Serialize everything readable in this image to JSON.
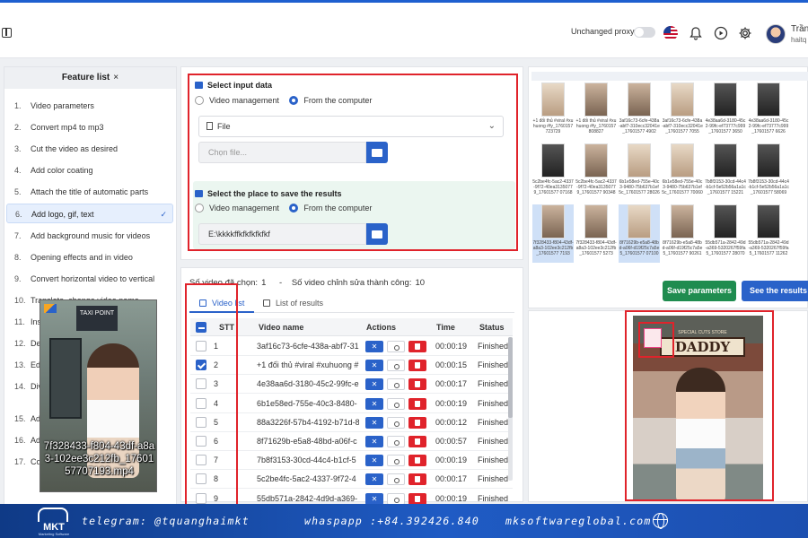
{
  "header": {
    "proxy_label": "Unchanged proxy",
    "user_name": "Trần",
    "user_sub": "haitq"
  },
  "feature_list": {
    "title": "Feature list",
    "close": "×",
    "items": [
      {
        "num": "1.",
        "label": "Video parameters"
      },
      {
        "num": "2.",
        "label": "Convert mp4 to mp3"
      },
      {
        "num": "3.",
        "label": "Cut the video as desired"
      },
      {
        "num": "4.",
        "label": "Add color coating"
      },
      {
        "num": "5.",
        "label": "Attach the title of automatic parts"
      },
      {
        "num": "6.",
        "label": "Add logo, gif, text"
      },
      {
        "num": "7.",
        "label": "Add background music for videos"
      },
      {
        "num": "8.",
        "label": "Opening effects and in video"
      },
      {
        "num": "9.",
        "label": "Convert horizontal video to vertical"
      },
      {
        "num": "10.",
        "label": "Translate, change video name"
      },
      {
        "num": "11.",
        "label": "Insert"
      },
      {
        "num": "12.",
        "label": "Delete"
      },
      {
        "num": "13.",
        "label": "Edit"
      },
      {
        "num": "14.",
        "label": "Divide parts"
      },
      {
        "num": "15.",
        "label": "Add"
      },
      {
        "num": "16.",
        "label": "Add"
      },
      {
        "num": "17.",
        "label": "Convert"
      }
    ],
    "active_check": "✓"
  },
  "overlay": {
    "sign_text": "TAXI POINT",
    "caption": "7f328433-f804-43df-a8a3-102ee3c212fb_1760157707193.mp4"
  },
  "input_section": {
    "title": "Select input data",
    "option_a": "Video management",
    "option_b": "From the computer",
    "file_select": "File",
    "chevron": "⌄",
    "file_placeholder": "Chọn file..."
  },
  "save_section": {
    "title": "Select the place to save the results",
    "option_a": "Video management",
    "option_b": "From the computer",
    "path": "E:\\kkkkffkfkfkfkfkf"
  },
  "grid": {
    "thumbs": [
      {
        "label": "+1 đối thủ #viral #xuhuong #fy_1760157723729"
      },
      {
        "label": "+1 đối thủ #viral #xuhuong #fy_1760157808827"
      },
      {
        "label": "3af16c73-6cfe-438a-abf7-310ecc32041e_17601577 4902"
      },
      {
        "label": "3af16c73-6cfe-438a-abf7-310ecc32041e_17601577 7055"
      },
      {
        "label": "4e38aa6d-3180-45c2-99fc-ef73777c999_17601577 3650"
      },
      {
        "label": "4e38aa6d-3180-45c2-99fc-ef73777c999_17601577 6626"
      },
      {
        "label": "5c2be4fc-5ac2-4337-9f72-40ea31350779_17601577 07168"
      },
      {
        "label": "5c2be4fc-5ac2-4337-9f72-40ea31350779_17601577 90348"
      },
      {
        "label": "6b1e58ed-755e-40c3-9480-75b637b1ef5c_17601577 28026"
      },
      {
        "label": "6b1e58ed-755e-40c3-9480-75b637b1ef5c_17601577 70060"
      },
      {
        "label": "7b8f3153-30cd-44c4-b1cf-5e52b56a1a1c_17601577 15221"
      },
      {
        "label": "7b8f3153-30cd-44c4-b1cf-5e52b56a1a1c_17601577 58069"
      },
      {
        "label": "7f328433-f804-43df-a8a3-102ee3c212fb_17601577 7193"
      },
      {
        "label": "7f328433-f804-43df-a8a3-102ee3c212fb_17601577 5273"
      },
      {
        "label": "8f71629b-e5a8-48bd-a06f-d19f25c7a5e5_17601577 07100"
      },
      {
        "label": "8f71629b-e5a8-48bd-a06f-d19f25c7a5e5_17601577 90261"
      },
      {
        "label": "55db571a-2842-49d-a369-5320267f59fa5_17601577 28070"
      },
      {
        "label": "55db571a-2842-49d-a369-5320267f59fa5_17601577 11262"
      }
    ],
    "save_btn": "Save parameters",
    "see_btn": "See the results fo"
  },
  "preview": {
    "sign": "DADDY",
    "sub_sign": "SPECIAL CUTS STORE"
  },
  "results": {
    "selected_label": "Số video đã chọn:",
    "selected_count": "1",
    "sep": "-",
    "success_label": "Số video chỉnh sửa thành công:",
    "success_count": "10",
    "tab_video_list": "Video list",
    "tab_results": "List of results",
    "columns": {
      "stt": "STT",
      "name": "Video name",
      "actions": "Actions",
      "time": "Time",
      "status": "Status"
    },
    "rows": [
      {
        "stt": "1",
        "name": "3af16c73-6cfe-438a-abf7-31",
        "time": "00:00:19",
        "status": "Finished",
        "checked": false
      },
      {
        "stt": "2",
        "name": "+1 đối thủ #viral #xuhuong #",
        "time": "00:00:15",
        "status": "Finished",
        "checked": true
      },
      {
        "stt": "3",
        "name": "4e38aa6d-3180-45c2-99fc-e",
        "time": "00:00:17",
        "status": "Finished",
        "checked": false
      },
      {
        "stt": "4",
        "name": "6b1e58ed-755e-40c3-8480-",
        "time": "00:00:19",
        "status": "Finished",
        "checked": false
      },
      {
        "stt": "5",
        "name": "88a3226f-57b4-4192-b71d-8",
        "time": "00:00:12",
        "status": "Finished",
        "checked": false
      },
      {
        "stt": "6",
        "name": "8f71629b-e5a8-48bd-a06f-c",
        "time": "00:00:57",
        "status": "Finished",
        "checked": false
      },
      {
        "stt": "7",
        "name": "7b8f3153-30cd-44c4-b1cf-5",
        "time": "00:00:19",
        "status": "Finished",
        "checked": false
      },
      {
        "stt": "8",
        "name": "5c2be4fc-5ac2-4337-9f72-4",
        "time": "00:00:17",
        "status": "Finished",
        "checked": false
      },
      {
        "stt": "9",
        "name": "55db571a-2842-4d9d-a369-",
        "time": "00:00:19",
        "status": "Finished",
        "checked": false
      }
    ]
  },
  "footer": {
    "logo": "MKT",
    "logo_tag": "Marketing Software",
    "telegram": "telegram: @tquanghaimkt",
    "whatsapp": "whaspapp :+84.392426.840",
    "website": "mksoftwareglobal.com"
  },
  "colors": {
    "accent": "#2a62c9",
    "green": "#1f8c4f",
    "red_highlight": "#e0232b",
    "footer": "#1f5bc4"
  },
  "icons": [
    "layout-icon",
    "flag-icon",
    "bell-icon",
    "play-icon",
    "gear-icon",
    "folder-icon",
    "check-icon",
    "trash-icon",
    "scissors-icon",
    "globe-icon"
  ]
}
